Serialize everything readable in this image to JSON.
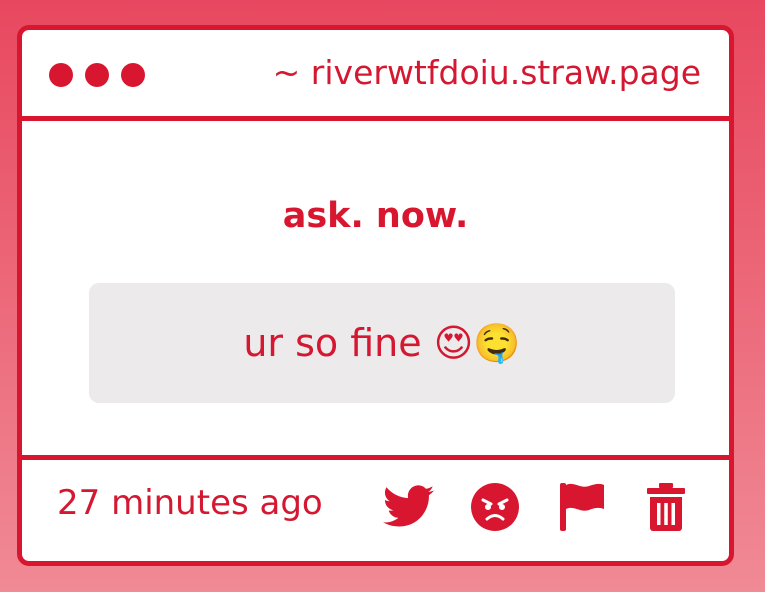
{
  "window": {
    "url": "~ riverwtfdoiu.straw.page",
    "dots": [
      "dot-1",
      "dot-2",
      "dot-3"
    ]
  },
  "main": {
    "heading": "ask. now.",
    "question": "ur so fine 😍🤤"
  },
  "footer": {
    "timestamp": "27 minutes ago",
    "actions": [
      {
        "name": "twitter-share",
        "icon": "twitter-icon"
      },
      {
        "name": "angry-reaction",
        "icon": "angry-face-icon"
      },
      {
        "name": "report",
        "icon": "flag-icon"
      },
      {
        "name": "delete",
        "icon": "trash-icon"
      }
    ]
  },
  "colors": {
    "accent": "#d91630",
    "background_top": "#e8485f",
    "background_bottom": "#f08a95",
    "card": "#ffffff",
    "question_box": "#eceaeb"
  }
}
